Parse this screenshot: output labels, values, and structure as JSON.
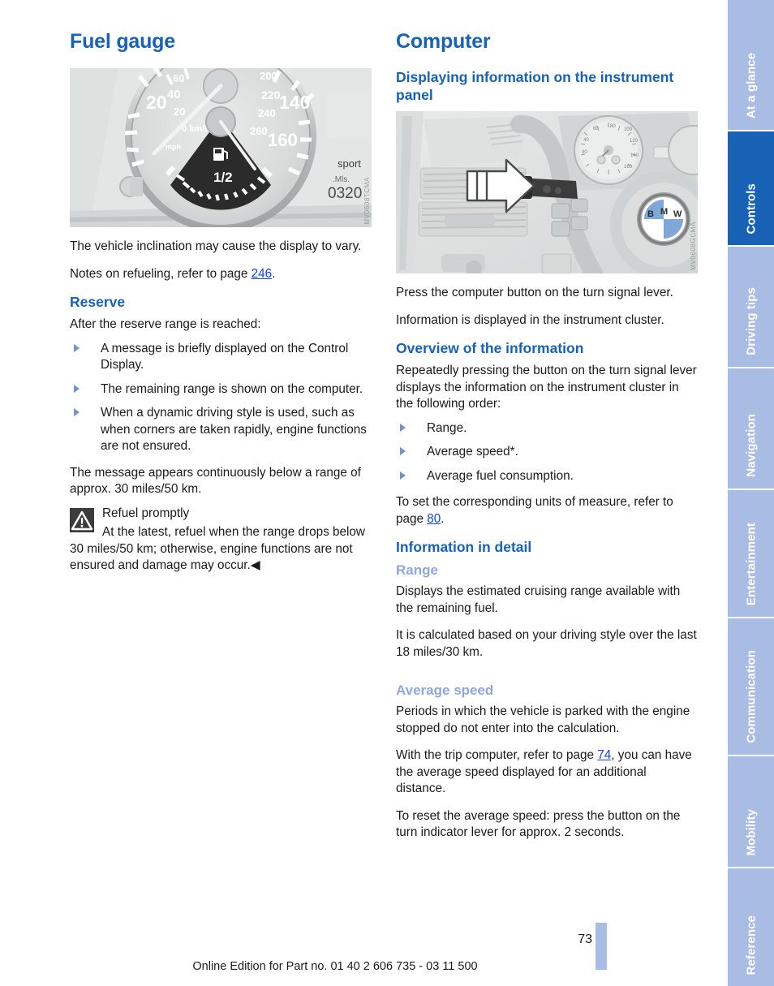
{
  "left_column": {
    "chapter_title": "Fuel gauge",
    "figure": {
      "caption_code": "MV0608TCMA",
      "alt": "instrument-cluster-fuel-gauge"
    },
    "paragraphs": {
      "p1": "The vehicle inclination may cause the display to vary.",
      "p2_before": "Notes on refueling, refer to page ",
      "p2_link": "246",
      "p2_after": "."
    },
    "reserve": {
      "heading": "Reserve",
      "intro": "After the reserve range is reached:",
      "bullets": [
        "A message is briefly displayed on the Control Display.",
        "The remaining range is shown on the computer.",
        "When a dynamic driving style is used, such as when corners are taken rapidly, engine functions are not ensured."
      ],
      "after": "The message appears continuously below a range of approx. 30 miles/50 km."
    },
    "warning": {
      "icon": "warning-triangle-icon",
      "title": "Refuel promptly",
      "text": "At the latest, refuel when the range drops below 30 miles/50 km; otherwise, engine functions are not ensured and damage may occur.",
      "end_mark": "◀"
    }
  },
  "right_column": {
    "chapter_title": "Computer",
    "displaying": {
      "heading": "Displaying information on the instrument panel",
      "figure": {
        "caption_code": "MV0608GCMA",
        "alt": "turn-signal-lever-computer-button"
      },
      "p1": "Press the computer button on the turn signal lever.",
      "p2": "Information is displayed in the instrument cluster."
    },
    "overview": {
      "heading": "Overview of the information",
      "intro": "Repeatedly pressing the button on the turn signal lever displays the information on the instrument cluster in the following order:",
      "bullets": [
        "Range.",
        "Average speed*.",
        "Average fuel consumption."
      ],
      "after_before": "To set the corresponding units of measure, refer to page ",
      "after_link": "80",
      "after_after": "."
    },
    "detail": {
      "heading": "Information in detail",
      "range": {
        "heading": "Range",
        "p1": "Displays the estimated cruising range available with the remaining fuel.",
        "p2": "It is calculated based on your driving style over the last 18 miles/30 km."
      },
      "average_speed": {
        "heading": "Average speed",
        "p1": "Periods in which the vehicle is parked with the engine stopped do not enter into the calculation.",
        "p2_before": "With the trip computer, refer to page ",
        "p2_link": "74",
        "p2_after": ", you can have the average speed displayed for an additional distance.",
        "p3": "To reset the average speed: press the button on the turn indicator lever for approx. 2 seconds."
      }
    }
  },
  "rail": {
    "tabs": [
      {
        "label": "At a glance",
        "active": false
      },
      {
        "label": "Controls",
        "active": true
      },
      {
        "label": "Driving tips",
        "active": false
      },
      {
        "label": "Navigation",
        "active": false
      },
      {
        "label": "Entertainment",
        "active": false
      },
      {
        "label": "Communication",
        "active": false
      },
      {
        "label": "Mobility",
        "active": false
      },
      {
        "label": "Reference",
        "active": false
      }
    ]
  },
  "footer": {
    "page_number": "73",
    "imprint": "Online Edition for Part no. 01 40 2 606 735 - 03 11 500"
  },
  "colors": {
    "accent_blue": "#1862b5",
    "light_blue": "#a9bde4",
    "sub_heading_blue": "#8fa9d8",
    "link_blue": "#1145e0",
    "bullet_blue": "#6e93cf"
  }
}
